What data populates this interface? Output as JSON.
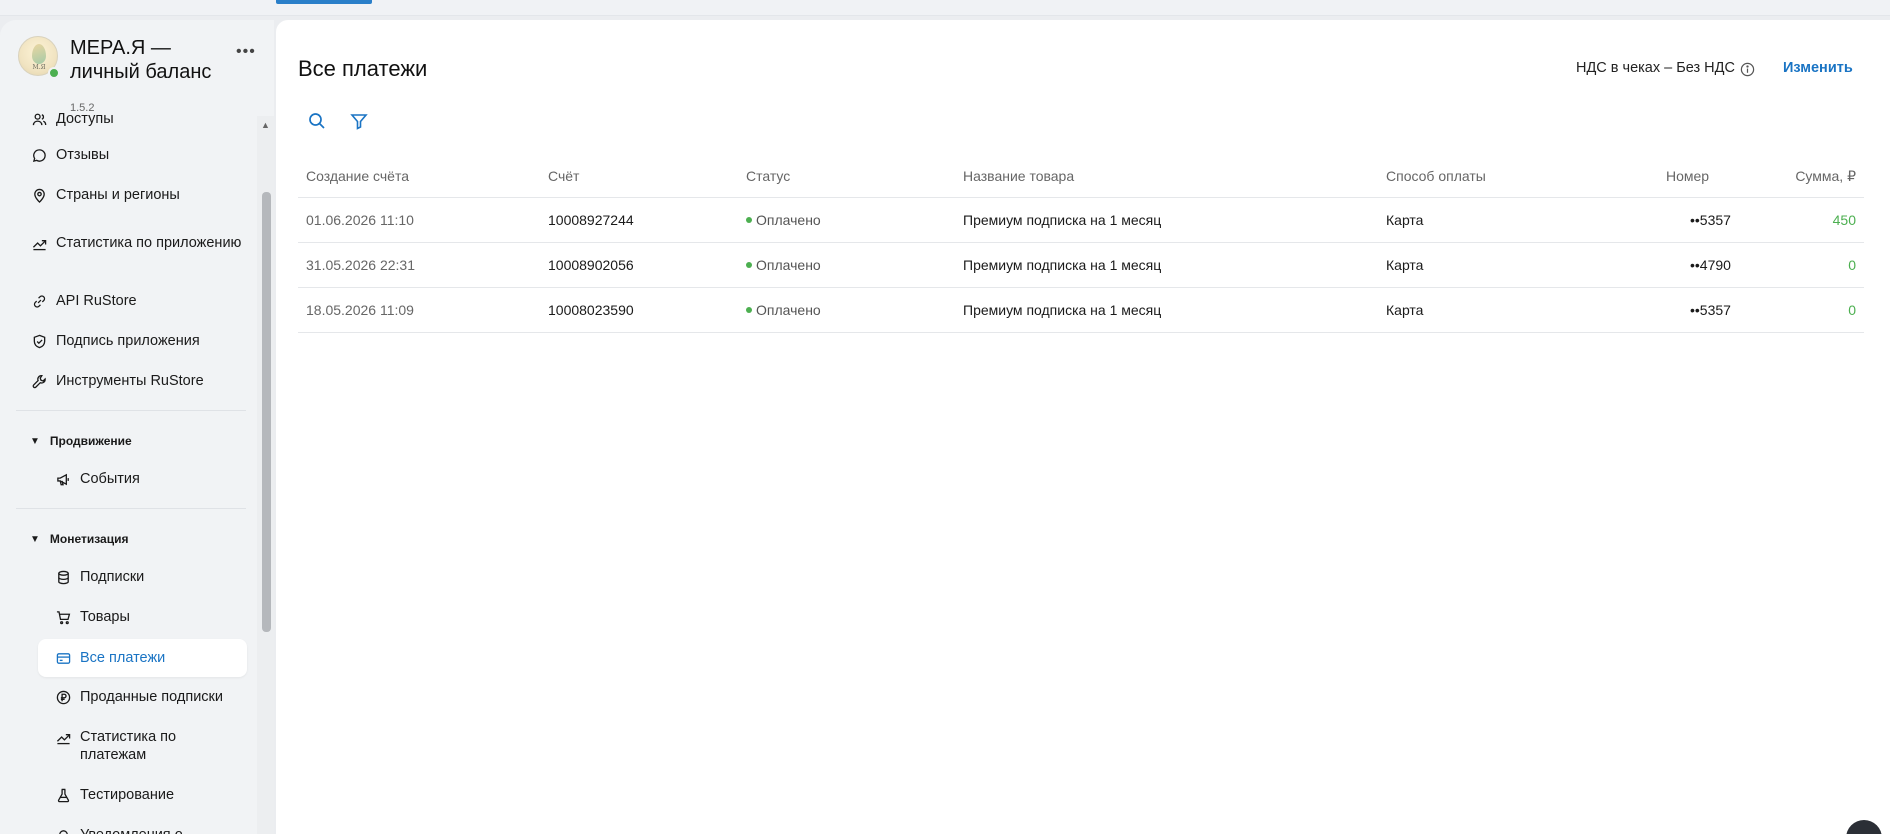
{
  "app": {
    "name": "МЕРА.Я — личный баланс",
    "version": "1.5.2",
    "logo_text": "М.Я",
    "more_icon": "more-horizontal-icon"
  },
  "sidebar": {
    "items": [
      {
        "label": "Доступы",
        "icon": "users-icon"
      },
      {
        "label": "Отзывы",
        "icon": "chat-bubble-icon"
      },
      {
        "label": "Страны и регионы",
        "icon": "map-pin-icon"
      },
      {
        "label": "Статистика по приложению",
        "icon": "trend-up-icon"
      },
      {
        "label": "API RuStore",
        "icon": "link-icon"
      },
      {
        "label": "Подпись приложения",
        "icon": "shield-check-icon"
      },
      {
        "label": "Инструменты RuStore",
        "icon": "wrench-icon"
      }
    ],
    "sections": [
      {
        "title": "Продвижение",
        "items": [
          {
            "label": "События",
            "icon": "megaphone-icon"
          }
        ]
      },
      {
        "title": "Монетизация",
        "items": [
          {
            "label": "Подписки",
            "icon": "database-icon"
          },
          {
            "label": "Товары",
            "icon": "cart-icon"
          },
          {
            "label": "Все платежи",
            "icon": "card-icon",
            "active": true
          },
          {
            "label": "Проданные подписки",
            "icon": "ruble-coin-icon"
          },
          {
            "label": "Статистика по платежам",
            "icon": "trend-up-icon"
          },
          {
            "label": "Тестирование",
            "icon": "flask-icon"
          },
          {
            "label": "Уведомления о",
            "icon": "bell-icon"
          }
        ]
      }
    ]
  },
  "main": {
    "title": "Все платежи",
    "vat_label": "НДС в чеках – Без НДС",
    "change_label": "Изменить",
    "toolbar": {
      "search_icon": "search-icon",
      "filter_icon": "filter-icon"
    },
    "table": {
      "columns": [
        "Создание счёта",
        "Счёт",
        "Статус",
        "Название товара",
        "Способ оплаты",
        "Номер",
        "Сумма, ₽"
      ],
      "rows": [
        {
          "created": "01.06.2026 11:10",
          "invoice": "10008927244",
          "status": "Оплачено",
          "product": "Премиум подписка на 1 месяц",
          "method": "Карта",
          "number": "••5357",
          "amount": "450"
        },
        {
          "created": "31.05.2026 22:31",
          "invoice": "10008902056",
          "status": "Оплачено",
          "product": "Премиум подписка на 1 месяц",
          "method": "Карта",
          "number": "••4790",
          "amount": "0"
        },
        {
          "created": "18.05.2026 11:09",
          "invoice": "10008023590",
          "status": "Оплачено",
          "product": "Премиум подписка на 1 месяц",
          "method": "Карта",
          "number": "••5357",
          "amount": "0"
        }
      ]
    }
  },
  "colors": {
    "accent": "#1a74c4",
    "status_paid": "#4caf50",
    "sidebar_bg": "#f1f3f5"
  }
}
